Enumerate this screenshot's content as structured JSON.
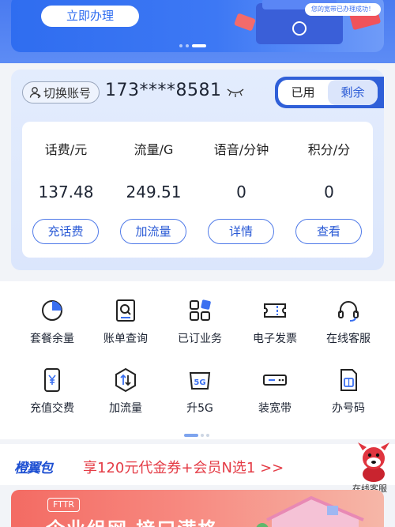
{
  "banner": {
    "title": "立即办理",
    "button_label": "立即办理",
    "notice": "您的宽带已办理成功！"
  },
  "account": {
    "switch_label": "切换账号",
    "phone": "173****8581",
    "toggle": {
      "options": [
        "已用",
        "剩余"
      ],
      "selected": "剩余"
    }
  },
  "stats": [
    {
      "label": "话费/元",
      "value": "137.48",
      "button": "充话费"
    },
    {
      "label": "流量/G",
      "value": "249.51",
      "button": "加流量"
    },
    {
      "label": "语音/分钟",
      "value": "0",
      "button": "详情"
    },
    {
      "label": "积分/分",
      "value": "0",
      "button": "查看"
    }
  ],
  "services": [
    {
      "label": "套餐余量",
      "icon": "pie-chart-icon"
    },
    {
      "label": "账单查询",
      "icon": "bill-search-icon"
    },
    {
      "label": "已订业务",
      "icon": "grid-apps-icon"
    },
    {
      "label": "电子发票",
      "icon": "ticket-icon"
    },
    {
      "label": "在线客服",
      "icon": "headset-icon"
    },
    {
      "label": "充值交费",
      "icon": "phone-yuan-icon"
    },
    {
      "label": "加流量",
      "icon": "data-arrows-icon"
    },
    {
      "label": "升5G",
      "icon": "5g-icon"
    },
    {
      "label": "装宽带",
      "icon": "router-icon"
    },
    {
      "label": "办号码",
      "icon": "sim-card-icon"
    }
  ],
  "promo": {
    "logo": "橙翼包",
    "text": "享120元代金券+会员N选1 >>"
  },
  "floating_service": {
    "label": "在线客服"
  },
  "bottom_banner": {
    "tag": "FTTR",
    "title": "企业组网 接口满格"
  },
  "colors": {
    "brand_blue": "#2f6df0",
    "promo_red": "#e43c46"
  }
}
